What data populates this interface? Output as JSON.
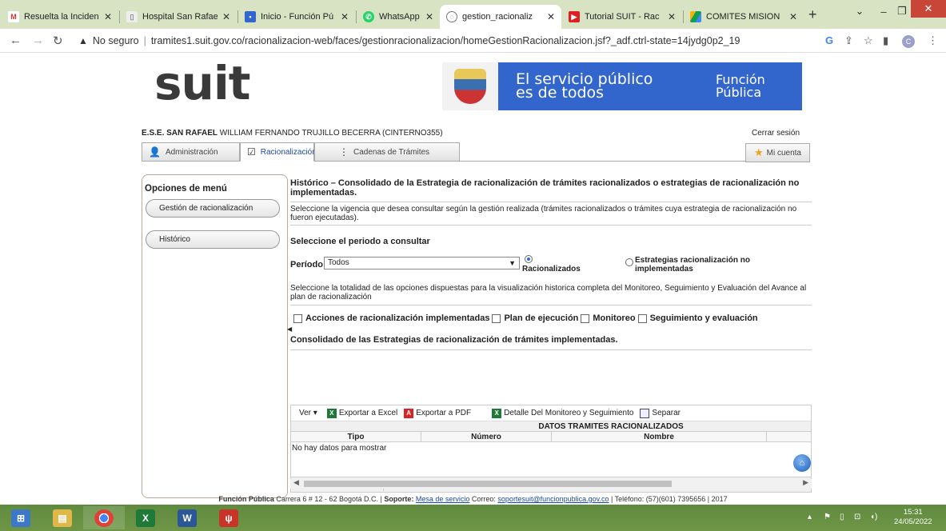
{
  "browser": {
    "tabs": [
      {
        "title": "Resuelta la Inciden",
        "favicon": "gmail-icon",
        "active": false
      },
      {
        "title": "Hospital San Rafae",
        "favicon": "hospital-icon",
        "active": false
      },
      {
        "title": "Inicio - Función Pú",
        "favicon": "funcion-publica-icon",
        "active": false
      },
      {
        "title": "WhatsApp",
        "favicon": "whatsapp-icon",
        "active": false
      },
      {
        "title": "gestion_racionaliz",
        "favicon": "globe-icon",
        "active": true
      },
      {
        "title": "Tutorial SUIT - Rac",
        "favicon": "youtube-icon",
        "active": false
      },
      {
        "title": "COMITES MISION",
        "favicon": "google-drive-icon",
        "active": false
      }
    ],
    "new_tab": "+",
    "security_label": "No seguro",
    "url": "tramites1.suit.gov.co/racionalizacion-web/faces/gestionracionalizacion/homeGestionRacionalizacion.jsf?_adf.ctrl-state=14jydg0p2_19",
    "profile_initial": "C"
  },
  "header": {
    "logo": "suit",
    "motto_line1": "El servicio público",
    "motto_line2": "es de todos",
    "brand_line1": "Función",
    "brand_line2": "Pública"
  },
  "user": {
    "entity": "E.S.E. SAN RAFAEL",
    "name": "WILLIAM FERNANDO TRUJILLO BECERRA (CINTERNO355)",
    "logout": "Cerrar sesión"
  },
  "nav": {
    "tabs": [
      "Administración",
      "Racionalización",
      "Cadenas de Trámites"
    ],
    "account": "Mi cuenta"
  },
  "sidebar": {
    "title": "Opciones de menú",
    "items": [
      "Gestión de racionalización",
      "Histórico"
    ]
  },
  "main": {
    "heading": "Histórico – Consolidado de la Estrategia de racionalización de trámites racionalizados o estrategias de racionalización no implementadas.",
    "instructions": "Seleccione la vigencia que desea consultar según la gestión realizada (trámites racionalizados o trámites cuya estrategia de racionalización no fueron ejecutadas).",
    "period_heading": "Seleccione el periodo a consultar",
    "period_label": "Período:",
    "period_value": "Todos",
    "radio_racionalizados": "Racionalizados",
    "radio_estrategias_line1": "Estrategias racionalización no",
    "radio_estrategias_line2": "implementadas",
    "options_text": "Seleccione la totalidad de las opciones dispuestas para la visualización historica completa del Monitoreo, Seguimiento y Evaluación del Avance al plan de racionalización",
    "checkboxes": [
      "Acciones de racionalización implementadas",
      "Plan de ejecución",
      "Monitoreo",
      "Seguimiento y evaluación"
    ],
    "consolidado": "Consolidado de las Estrategias de racionalización de trámites implementadas."
  },
  "table": {
    "toolbar": {
      "ver": "Ver ▾",
      "excel": "Exportar a Excel",
      "pdf": "Exportar a PDF",
      "detalle": "Detalle Del Monitoreo y Seguimiento",
      "separar": "Separar"
    },
    "group_header": "DATOS TRAMITES RACIONALIZADOS",
    "columns": [
      "Tipo",
      "Número",
      "Nombre"
    ],
    "empty": "No hay datos para mostrar"
  },
  "footer": {
    "org": "Función Pública",
    "address": "Carrera 6 # 12 - 62 Bogotá D.C. |",
    "support_label": "Soporte:",
    "support_link": "Mesa de servicio",
    "email_label": "Correo:",
    "email": "soportesuit@funcionpublica.gov.co",
    "phone": "| Teléfono: (57)(601) 7395656 | 2017"
  },
  "taskbar": {
    "time": "15:31",
    "date": "24/05/2022"
  }
}
